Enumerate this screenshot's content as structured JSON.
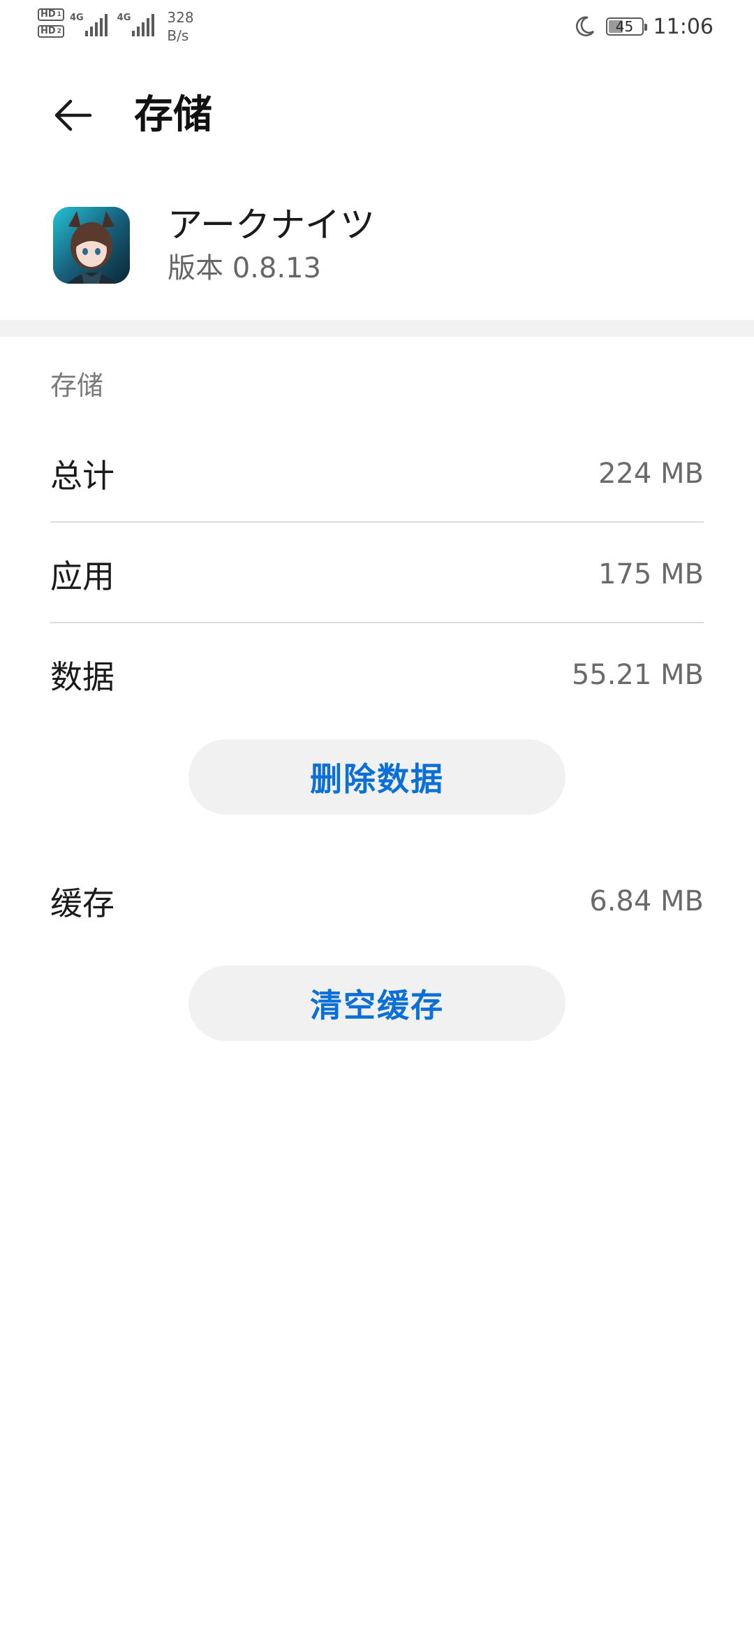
{
  "status_bar": {
    "hd1": "HD",
    "hd1_sub": "1",
    "hd2": "HD",
    "hd2_sub": "2",
    "net1": "4G",
    "net2": "4G",
    "speed_value": "328",
    "speed_unit": "B/s",
    "battery": "45",
    "battery_level_percent": 45,
    "time": "11:06"
  },
  "header": {
    "title": "存储"
  },
  "app": {
    "name": "アークナイツ",
    "version": "版本 0.8.13"
  },
  "storage": {
    "section_label": "存储",
    "total_label": "总计",
    "total_value": "224 MB",
    "app_label": "应用",
    "app_value": "175 MB",
    "data_label": "数据",
    "data_value": "55.21 MB",
    "clear_data_button": "删除数据",
    "cache_label": "缓存",
    "cache_value": "6.84 MB",
    "clear_cache_button": "清空缓存"
  },
  "colors": {
    "accent": "#0a6fd6",
    "button_bg": "#f1f1f1",
    "divider": "#dcdcdc"
  }
}
